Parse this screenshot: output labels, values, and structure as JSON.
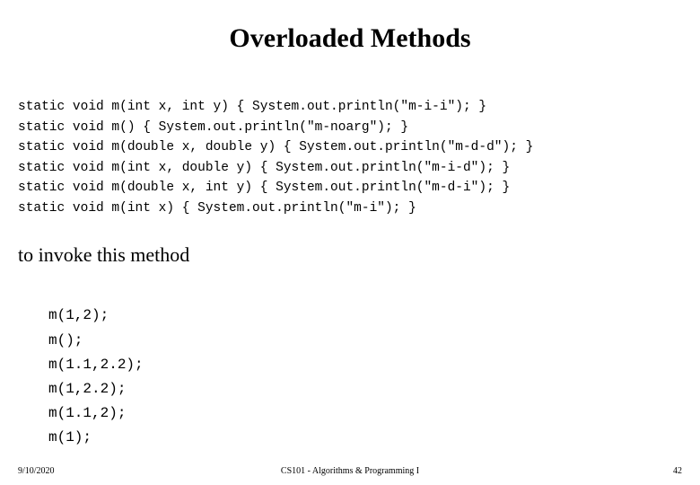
{
  "title": "Overloaded Methods",
  "methods": [
    "static void m(int x, int y) { System.out.println(\"m-i-i\"); }",
    "static void m() { System.out.println(\"m-noarg\"); }",
    "static void m(double x, double y) { System.out.println(\"m-d-d\"); }",
    "static void m(int x, double y) { System.out.println(\"m-i-d\"); }",
    "static void m(double x, int y) { System.out.println(\"m-d-i\"); }",
    "static void m(int x) { System.out.println(\"m-i\"); }"
  ],
  "subhead": "to invoke this method",
  "invocations": [
    "m(1,2);",
    "m();",
    "m(1.1,2.2);",
    "m(1,2.2);",
    "m(1.1,2);",
    "m(1);"
  ],
  "footer": {
    "date": "9/10/2020",
    "course": "CS101 - Algorithms & Programming I",
    "page": "42"
  }
}
